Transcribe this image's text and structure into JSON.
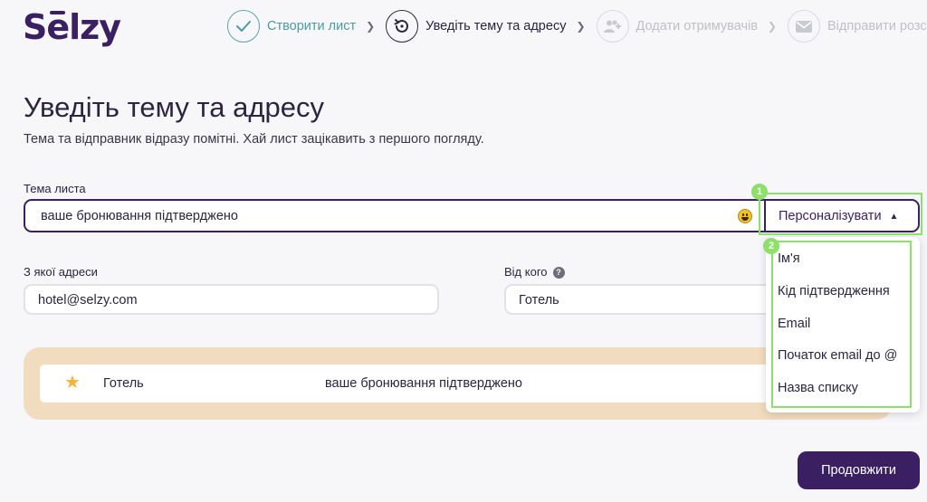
{
  "logo": {
    "prefix": "S",
    "e": "e",
    "suffix": "lzy"
  },
  "steps": [
    {
      "label": "Створити лист",
      "state": "done",
      "icon": "check-icon"
    },
    {
      "label": "Уведіть тему та адресу",
      "state": "active",
      "icon": "refresh-icon"
    },
    {
      "label": "Додати отримувачів",
      "state": "inactive",
      "icon": "add-users-icon"
    },
    {
      "label": "Відправити розсилку",
      "state": "inactive",
      "icon": "mail-icon"
    }
  ],
  "page": {
    "title": "Уведіть тему та адресу",
    "subtitle": "Тема та відправник відразу помітні. Хай лист зацікавить з першого погляду."
  },
  "subject": {
    "label": "Тема листа",
    "value": "ваше бронювання підтверджено",
    "personalize_label": "Персоналізувати"
  },
  "from_address": {
    "label": "З якої адреси",
    "value": "hotel@selzy.com"
  },
  "from_name": {
    "label": "Від кого",
    "value": "Готель",
    "help": "?"
  },
  "preview": {
    "sender": "Готель",
    "subject": "ваше бронювання підтверджено"
  },
  "dropdown": {
    "items": [
      "Ім'я",
      "Кід підтвердження",
      "Email",
      "Початок email до @",
      "Назва списку"
    ]
  },
  "annotations": [
    "1",
    "2"
  ],
  "continue_label": "Продовжити",
  "colors": {
    "primary": "#3b1f63",
    "done": "#4a9aa4",
    "highlight": "#8de06a",
    "preview_bg": "#f2dcbf"
  }
}
